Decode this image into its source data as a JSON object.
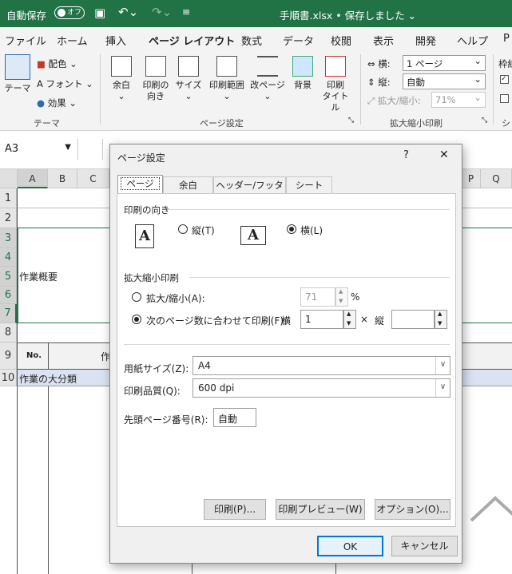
{
  "titlebar": {
    "autosave": "自動保存",
    "toggle": "オフ",
    "title": "手順書.xlsx • 保存しました ⌄"
  },
  "tabs": [
    "ファイル",
    "ホーム",
    "挿入",
    "ページ レイアウト",
    "数式",
    "データ",
    "校閲",
    "表示",
    "開発",
    "ヘルプ",
    "P"
  ],
  "ribbon": {
    "theme": {
      "themes": "テーマ",
      "colors": "配色",
      "fonts": "フォント",
      "effects": "効果",
      "group": "テーマ"
    },
    "setup": {
      "margins": "余白",
      "orientation": "印刷の\n向き",
      "size": "サイズ",
      "print_area": "印刷範囲",
      "breaks": "改ページ",
      "background": "背景",
      "titles": "印刷\nタイトル",
      "group": "ページ設定"
    },
    "scale": {
      "width_label": "横:",
      "width_value": "1 ページ",
      "height_label": "縦:",
      "height_value": "自動",
      "scale_label": "拡大/縮小:",
      "scale_value": "71%",
      "group": "拡大縮小印刷"
    },
    "sheet_opts": {
      "label": "枠線",
      "group": "シ"
    }
  },
  "formula_bar": {
    "name_box": "A3"
  },
  "grid": {
    "columns": [
      "A",
      "B",
      "C",
      "P",
      "Q"
    ],
    "rows": [
      "1",
      "2",
      "3",
      "4",
      "5",
      "6",
      "7",
      "8",
      "9",
      "10"
    ],
    "cells": {
      "a5": "作業概要",
      "a9": "No.",
      "c9": "作",
      "a10": "作業の大分類"
    }
  },
  "dialog": {
    "title": "ページ設定",
    "help": "?",
    "close": "✕",
    "tabs": [
      "ページ",
      "余白",
      "ヘッダー/フッター",
      "シート"
    ],
    "orientation": {
      "heading": "印刷の向き",
      "portrait": "縦(T)",
      "landscape": "横(L)",
      "selected": "landscape"
    },
    "scaling": {
      "heading": "拡大縮小印刷",
      "adjust_label": "拡大/縮小(A):",
      "adjust_value": "71",
      "percent": "%",
      "fit_label": "次のページ数に合わせて印刷(F):",
      "wide_label": "横",
      "wide_value": "1",
      "times": "×",
      "tall_label": "縦",
      "tall_value": ""
    },
    "paper_size": {
      "label": "用紙サイズ(Z):",
      "value": "A4"
    },
    "print_quality": {
      "label": "印刷品質(Q):",
      "value": "600 dpi"
    },
    "first_page": {
      "label": "先頭ページ番号(R):",
      "value": "自動"
    },
    "buttons": {
      "print": "印刷(P)...",
      "preview": "印刷プレビュー(W)",
      "options": "オプション(O)...",
      "ok": "OK",
      "cancel": "キャンセル"
    }
  }
}
